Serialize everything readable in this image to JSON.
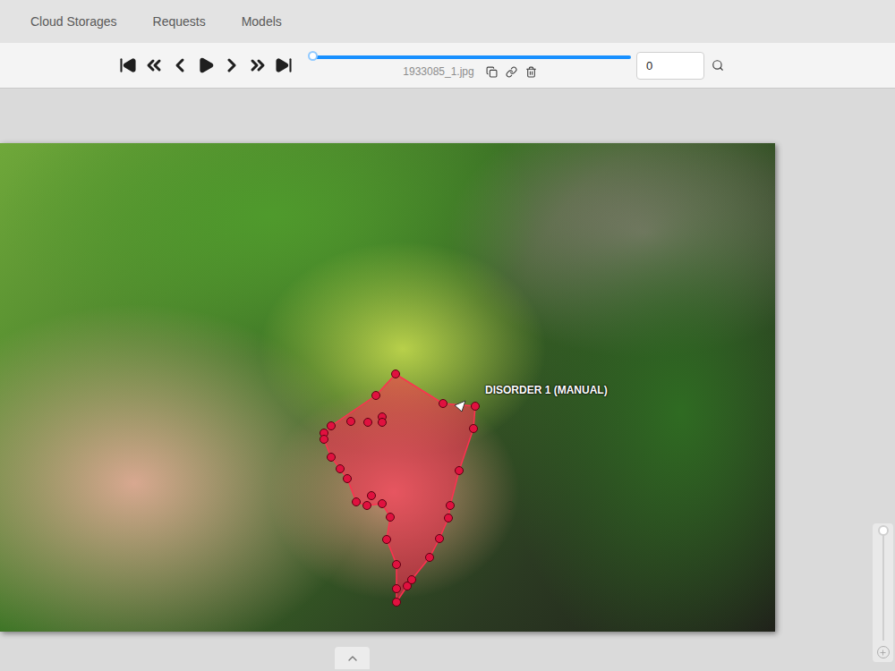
{
  "nav": {
    "items": [
      {
        "label": "Cloud Storages"
      },
      {
        "label": "Requests"
      },
      {
        "label": "Models"
      }
    ]
  },
  "player": {
    "slider": {
      "level": 0
    },
    "filename": "1933085_1.jpg",
    "frame": "0"
  },
  "canvas": {
    "annotation": {
      "label": "DISORDER 1 (MANUAL)"
    },
    "zoom": {
      "level": 1
    }
  }
}
